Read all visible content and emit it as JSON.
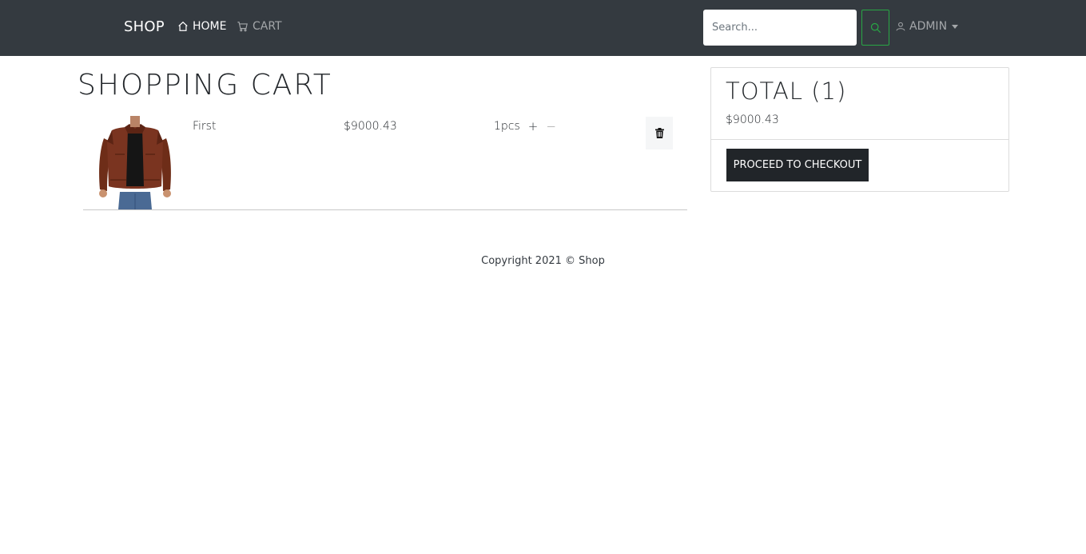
{
  "navbar": {
    "brand": "SHOP",
    "links": [
      {
        "label": "HOME",
        "icon": "house-icon",
        "active": true
      },
      {
        "label": "CART",
        "icon": "cart-icon",
        "active": false
      }
    ],
    "search": {
      "placeholder": "Search...",
      "value": ""
    },
    "user_menu": {
      "label": "ADMIN",
      "icon": "user-icon"
    }
  },
  "page": {
    "title": "SHOPPING CART"
  },
  "cart_items": [
    {
      "name": "First",
      "price": "$9000.43",
      "quantity": "1pcs",
      "increase": "+",
      "decrease": "−"
    }
  ],
  "summary": {
    "title": "TOTAL (1)",
    "amount": "$9000.43",
    "checkout_label": "PROCEED TO CHECKOUT"
  },
  "footer": {
    "text": "Copyright 2021 © Shop"
  },
  "colors": {
    "navbar_bg": "#343a40",
    "search_button_border": "#28a745",
    "checkout_bg": "#212529"
  }
}
